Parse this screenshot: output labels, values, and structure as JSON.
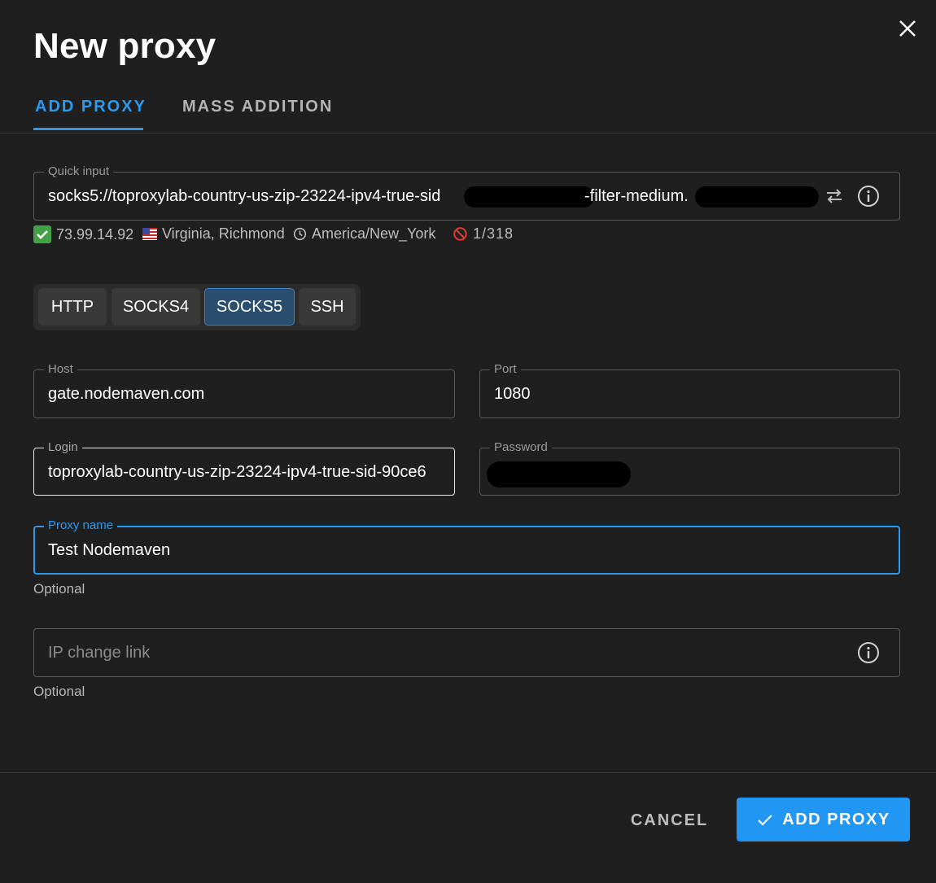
{
  "dialog": {
    "title": "New proxy"
  },
  "tabs": [
    {
      "label": "ADD PROXY",
      "active": true
    },
    {
      "label": "MASS ADDITION",
      "active": false
    }
  ],
  "quick_input": {
    "label": "Quick input",
    "value_visible_start": "socks5://toproxylab-country-us-zip-23224-ipv4-true-sid",
    "value_visible_middle": "-filter-medium."
  },
  "proxy_info": {
    "ip": "73.99.14.92",
    "location": "Virginia, Richmond",
    "timezone": "America/New_York",
    "blacklist": "1/318"
  },
  "protocols": [
    {
      "label": "HTTP",
      "selected": false
    },
    {
      "label": "SOCKS4",
      "selected": false
    },
    {
      "label": "SOCKS5",
      "selected": true
    },
    {
      "label": "SSH",
      "selected": false
    }
  ],
  "host": {
    "label": "Host",
    "value": "gate.nodemaven.com"
  },
  "port": {
    "label": "Port",
    "value": "1080"
  },
  "login": {
    "label": "Login",
    "value": "toproxylab-country-us-zip-23224-ipv4-true-sid-90ce6"
  },
  "password": {
    "label": "Password"
  },
  "proxy_name": {
    "label": "Proxy name",
    "value": "Test Nodemaven",
    "helper": "Optional"
  },
  "ip_change_link": {
    "placeholder": "IP change link",
    "helper": "Optional"
  },
  "footer": {
    "cancel_label": "CANCEL",
    "submit_label": "ADD PROXY"
  },
  "colors": {
    "accent": "#2196f3",
    "background": "#1f1f1f",
    "success": "#43a047",
    "danger": "#e53935"
  }
}
